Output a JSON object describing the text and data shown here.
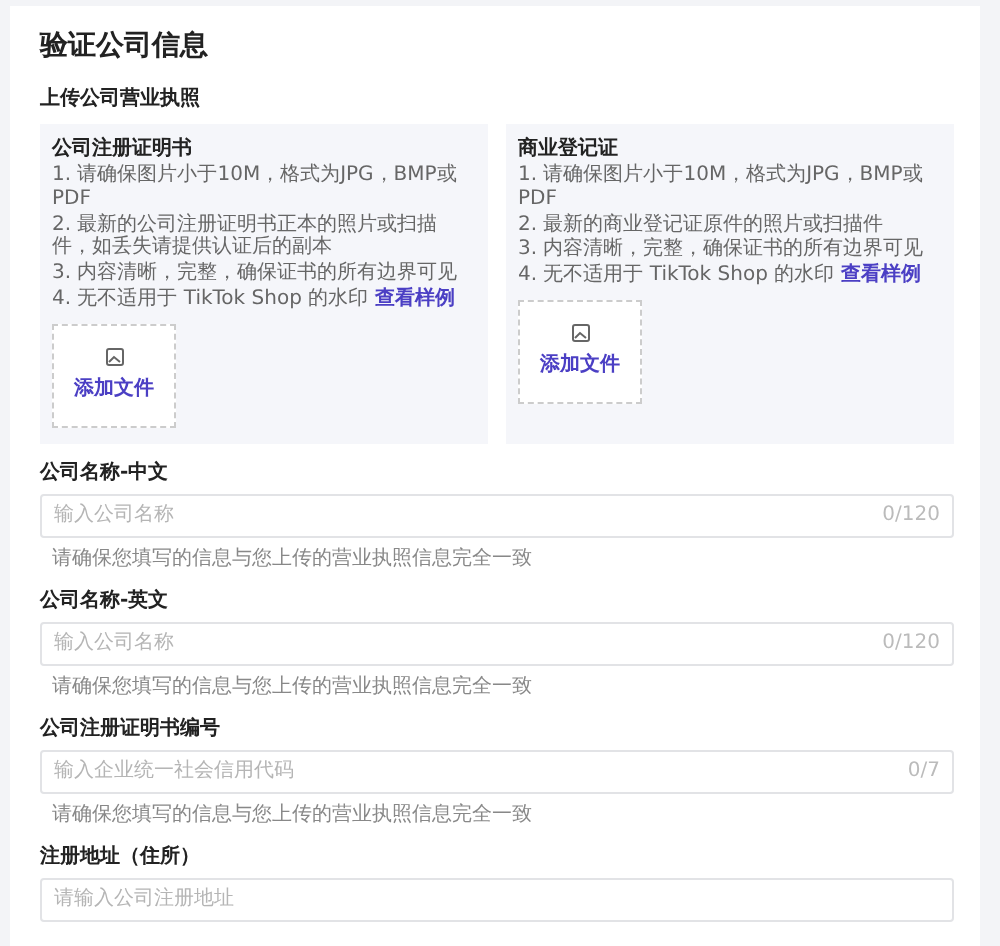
{
  "title": "验证公司信息",
  "upload_section": {
    "label": "上传公司营业执照",
    "cards": [
      {
        "title": "公司注册证明书",
        "requirements": [
          "1. 请确保图片小于10M，格式为JPG，BMP或PDF",
          "2. 最新的公司注册证明书正本的照片或扫描件，如丢失请提供认证后的副本",
          "3. 内容清晰，完整，确保证书的所有边界可见"
        ],
        "last_requirement": "4. 无不适用于 TikTok Shop 的水印",
        "sample_link": "查看样例",
        "upload_label": "添加文件"
      },
      {
        "title": "商业登记证",
        "requirements": [
          "1. 请确保图片小于10M，格式为JPG，BMP或PDF",
          "2. 最新的商业登记证原件的照片或扫描件",
          "3. 内容清晰，完整，确保证书的所有边界可见"
        ],
        "last_requirement": "4. 无不适用于 TikTok Shop 的水印",
        "sample_link": "查看样例",
        "upload_label": "添加文件"
      }
    ]
  },
  "fields": [
    {
      "label": "公司名称-中文",
      "placeholder": "输入公司名称",
      "counter": "0/120",
      "hint": "请确保您填写的信息与您上传的营业执照信息完全一致"
    },
    {
      "label": "公司名称-英文",
      "placeholder": "输入公司名称",
      "counter": "0/120",
      "hint": "请确保您填写的信息与您上传的营业执照信息完全一致"
    },
    {
      "label": "公司注册证明书编号",
      "placeholder": "输入企业统一社会信用代码",
      "counter": "0/7",
      "hint": "请确保您填写的信息与您上传的营业执照信息完全一致"
    },
    {
      "label": "注册地址（住所）",
      "placeholder": "请输入公司注册地址"
    }
  ]
}
